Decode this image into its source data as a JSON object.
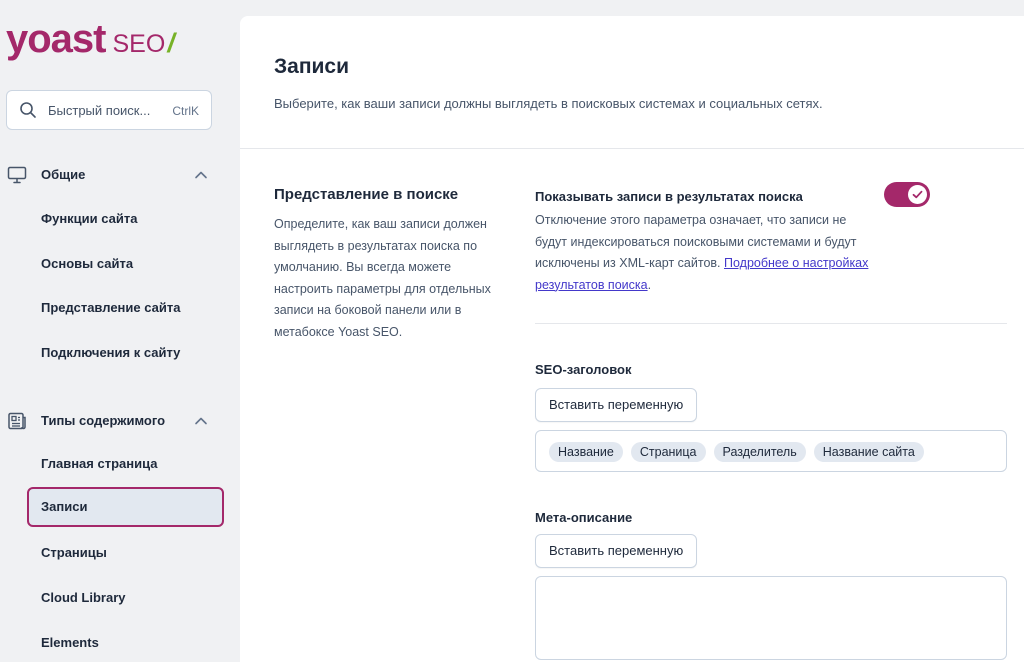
{
  "brand": {
    "logo_main": "yoast",
    "logo_suffix": "SEO",
    "logo_slash": "/",
    "primary_color": "#a4286a",
    "accent_color": "#77b227"
  },
  "sidebar": {
    "search": {
      "placeholder": "Быстрый поиск...",
      "shortcut": "CtrlK",
      "icon": "search-icon"
    },
    "groups": [
      {
        "label": "Общие",
        "icon": "desktop-icon",
        "expanded": true,
        "items": [
          {
            "label": "Функции сайта"
          },
          {
            "label": "Основы сайта"
          },
          {
            "label": "Представление сайта"
          },
          {
            "label": "Подключения к сайту"
          }
        ]
      },
      {
        "label": "Типы содержимого",
        "icon": "newspaper-icon",
        "expanded": true,
        "items": [
          {
            "label": "Главная страница"
          },
          {
            "label": "Записи",
            "active": true
          },
          {
            "label": "Страницы"
          },
          {
            "label": "Cloud Library"
          },
          {
            "label": "Elements"
          }
        ]
      }
    ]
  },
  "main": {
    "title": "Записи",
    "subtitle": "Выберите, как ваши записи должны выглядеть в поисковых системах и социальных сетях.",
    "section": {
      "title": "Представление в поиске",
      "description": "Определите, как ваш записи должен выглядеть в результатах поиска по умолчанию. Вы всегда можете настроить параметры для отдельных записи на боковой панели или в метабоксе Yoast SEO."
    },
    "show_in_search": {
      "label": "Показывать записи в результатах поиска",
      "enabled": true,
      "description": "Отключение этого параметра означает, что записи не будут индексироваться поисковыми системами и будут исключены из XML-карт сайтов. ",
      "link_text": "Подробнее о настройках результатов поиска",
      "trailing": "."
    },
    "seo_title": {
      "label": "SEO-заголовок",
      "insert_button": "Вставить переменную",
      "chips": [
        "Название",
        "Страница",
        "Разделитель",
        "Название сайта"
      ]
    },
    "meta_description": {
      "label": "Мета-описание",
      "insert_button": "Вставить переменную",
      "value": ""
    }
  }
}
